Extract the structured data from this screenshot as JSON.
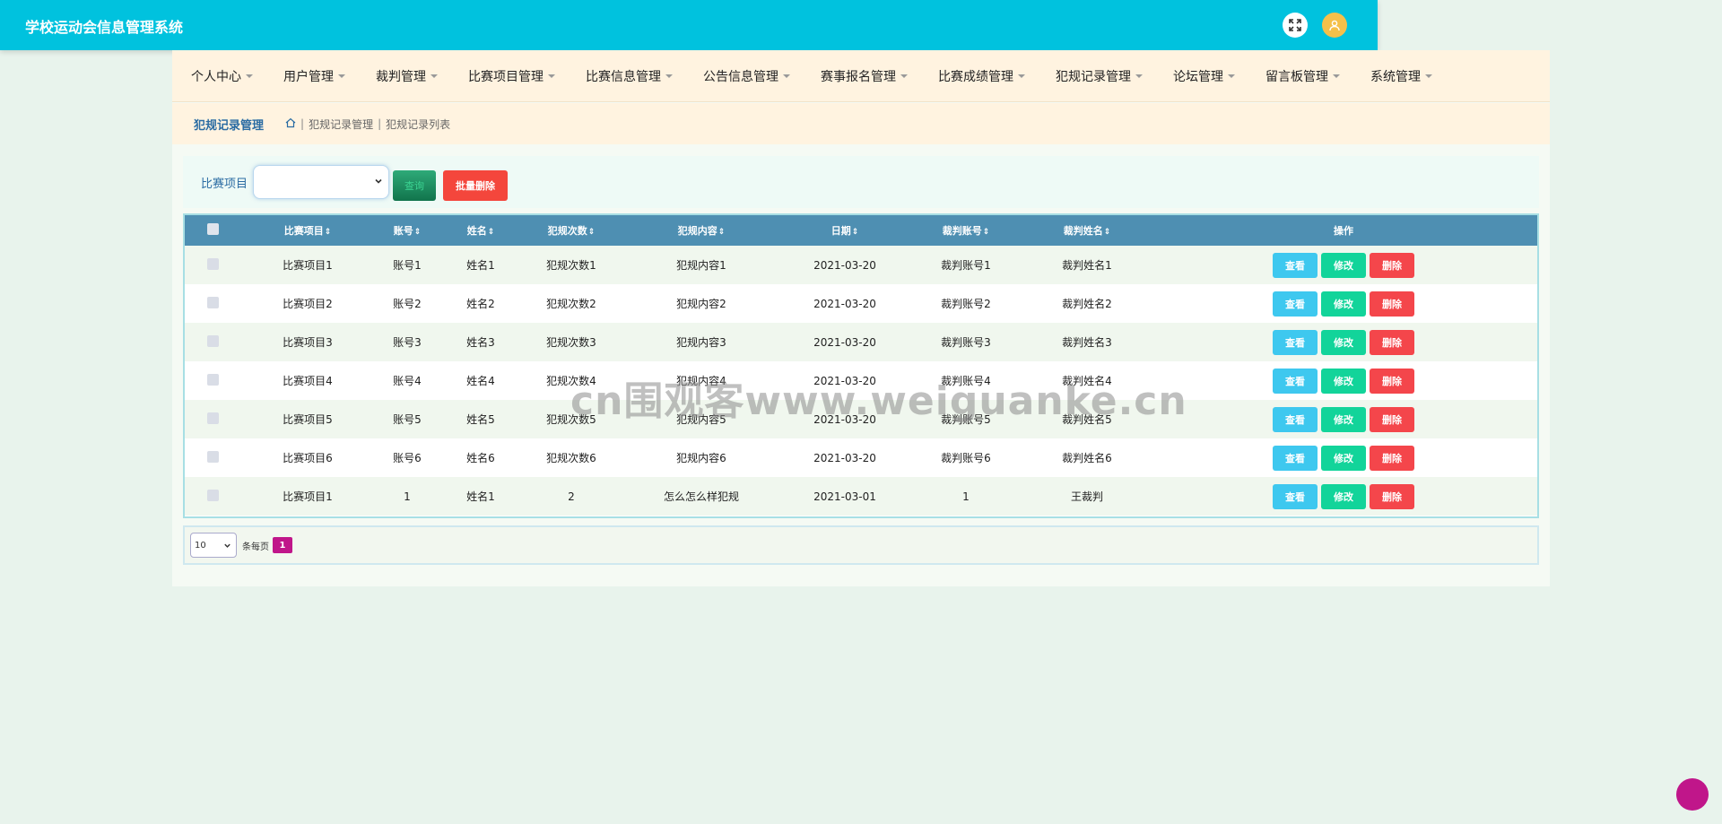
{
  "app": {
    "title": "学校运动会信息管理系统"
  },
  "nav": [
    "个人中心",
    "用户管理",
    "裁判管理",
    "比赛项目管理",
    "比赛信息管理",
    "公告信息管理",
    "赛事报名管理",
    "比赛成绩管理",
    "犯规记录管理",
    "论坛管理",
    "留言板管理",
    "系统管理"
  ],
  "breadcrumb": {
    "title": "犯规记录管理",
    "sep": "|",
    "crumb1": "犯规记录管理",
    "crumb2": "犯规记录列表"
  },
  "search": {
    "label": "比赛项目",
    "select_value": "",
    "search_btn": "查询",
    "bulk_delete": "批量删除"
  },
  "table": {
    "headers": [
      "比赛项目",
      "账号",
      "姓名",
      "犯规次数",
      "犯规内容",
      "日期",
      "裁判账号",
      "裁判姓名",
      "操作"
    ],
    "sort_glyph": "⇕",
    "rows": [
      [
        "比赛项目1",
        "账号1",
        "姓名1",
        "犯规次数1",
        "犯规内容1",
        "2021-03-20",
        "裁判账号1",
        "裁判姓名1"
      ],
      [
        "比赛项目2",
        "账号2",
        "姓名2",
        "犯规次数2",
        "犯规内容2",
        "2021-03-20",
        "裁判账号2",
        "裁判姓名2"
      ],
      [
        "比赛项目3",
        "账号3",
        "姓名3",
        "犯规次数3",
        "犯规内容3",
        "2021-03-20",
        "裁判账号3",
        "裁判姓名3"
      ],
      [
        "比赛项目4",
        "账号4",
        "姓名4",
        "犯规次数4",
        "犯规内容4",
        "2021-03-20",
        "裁判账号4",
        "裁判姓名4"
      ],
      [
        "比赛项目5",
        "账号5",
        "姓名5",
        "犯规次数5",
        "犯规内容5",
        "2021-03-20",
        "裁判账号5",
        "裁判姓名5"
      ],
      [
        "比赛项目6",
        "账号6",
        "姓名6",
        "犯规次数6",
        "犯规内容6",
        "2021-03-20",
        "裁判账号6",
        "裁判姓名6"
      ],
      [
        "比赛项目1",
        "1",
        "姓名1",
        "2",
        "怎么怎么样犯规",
        "2021-03-01",
        "1",
        "王裁判"
      ]
    ],
    "actions": {
      "view": "查看",
      "edit": "修改",
      "delete": "删除"
    }
  },
  "pager": {
    "page_size": "10",
    "per_page_label": "条每页",
    "current_page": "1"
  },
  "watermark": "cn围观客www.weiguanke.cn",
  "colors": {
    "topbar": "#00c2de",
    "header_row": "#4e8fb2",
    "view": "#3ec8ef",
    "edit": "#12d49a",
    "delete": "#f4464b",
    "accent": "#c0168a"
  }
}
